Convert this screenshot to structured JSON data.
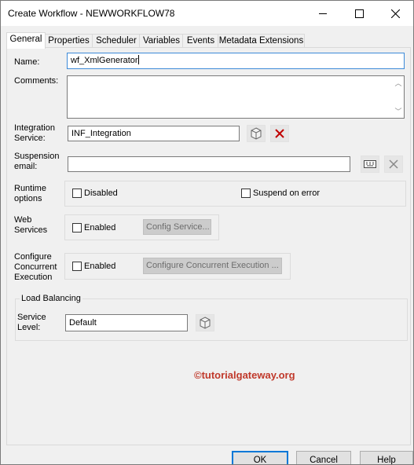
{
  "window": {
    "title": "Create Workflow - NEWWORKFLOW78"
  },
  "tabs": [
    "General",
    "Properties",
    "Scheduler",
    "Variables",
    "Events",
    "Metadata Extensions"
  ],
  "form": {
    "name_label": "Name:",
    "name_value": "wf_XmlGenerator",
    "comments_label": "Comments:",
    "comments_value": "",
    "integration_label_1": "Integration",
    "integration_label_2": "Service:",
    "integration_value": "INF_Integration",
    "suspension_label_1": "Suspension",
    "suspension_label_2": "email:",
    "suspension_value": "",
    "runtime_label_1": "Runtime",
    "runtime_label_2": "options",
    "disabled_label": "Disabled",
    "disabled_checked": false,
    "suspend_label": "Suspend on error",
    "suspend_checked": false,
    "web_label_1": "Web",
    "web_label_2": "Services",
    "web_enabled_label": "Enabled",
    "web_enabled_checked": false,
    "config_service_label": "Config Service...",
    "concurrent_label_1": "Configure",
    "concurrent_label_2": "Concurrent",
    "concurrent_label_3": "Execution",
    "concurrent_enabled_label": "Enabled",
    "concurrent_enabled_checked": false,
    "configure_concurrent_label": "Configure Concurrent Execution ..."
  },
  "load_balancing": {
    "legend": "Load Balancing",
    "service_level_label_1": "Service",
    "service_level_label_2": "Level:",
    "service_level_value": "Default"
  },
  "watermark": "©tutorialgateway.org",
  "buttons": {
    "ok": "OK",
    "cancel": "Cancel",
    "help": "Help"
  },
  "colors": {
    "focus_border": "#3c8ad8",
    "delete_red": "#c00000",
    "watermark": "#c0392b",
    "ok_border": "#0078d7"
  }
}
